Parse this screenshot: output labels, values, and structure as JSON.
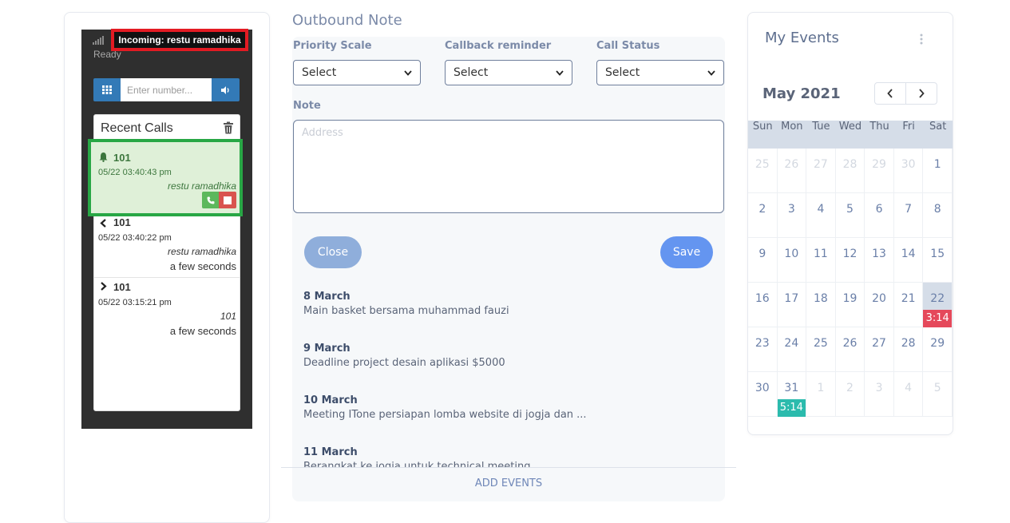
{
  "softphone": {
    "status": "Ready",
    "incoming_banner": "Incoming: restu ramadhika",
    "number_placeholder": "Enter number...",
    "recent_calls_title": "Recent Calls",
    "calls": [
      {
        "number": "101",
        "time": "05/22 03:40:43 pm",
        "name": "restu ramadhika",
        "direction": "incoming-ringing"
      },
      {
        "number": "101",
        "time": "05/22 03:40:22 pm",
        "name": "restu ramadhika",
        "ago": "a few seconds",
        "direction": "incoming"
      },
      {
        "number": "101",
        "time": "05/22 03:15:21 pm",
        "name": "101",
        "ago": "a few seconds",
        "direction": "outgoing"
      }
    ],
    "colors": {
      "incoming_border": "#e31b23",
      "active_call_border": "#28a745",
      "button_blue": "#337ab7"
    }
  },
  "outbound": {
    "title": "Outbound Note",
    "fields": {
      "priority_label": "Priority Scale",
      "priority_value": "Select",
      "callback_label": "Callback reminder",
      "callback_value": "Select",
      "status_label": "Call Status",
      "status_value": "Select",
      "note_label": "Note",
      "note_placeholder": "Address"
    },
    "close_label": "Close",
    "save_label": "Save",
    "events": [
      {
        "date": "8 March",
        "desc": "Main basket bersama muhammad fauzi"
      },
      {
        "date": "9 March",
        "desc": "Deadline project desain aplikasi $5000"
      },
      {
        "date": "10 March",
        "desc": "Meeting ITone persiapan lomba website di jogja dan ..."
      },
      {
        "date": "11 March",
        "desc": "Berangkat ke jogja untuk technical meeting"
      }
    ],
    "add_events_label": "ADD EVENTS"
  },
  "calendar": {
    "title": "My Events",
    "month": "May 2021",
    "weekdays": [
      "Sun",
      "Mon",
      "Tue",
      "Wed",
      "Thu",
      "Fri",
      "Sat"
    ],
    "weeks": [
      [
        "25",
        "26",
        "27",
        "28",
        "29",
        "30",
        "1"
      ],
      [
        "2",
        "3",
        "4",
        "5",
        "6",
        "7",
        "8"
      ],
      [
        "9",
        "10",
        "11",
        "12",
        "13",
        "14",
        "15"
      ],
      [
        "16",
        "17",
        "18",
        "19",
        "20",
        "21",
        "22"
      ],
      [
        "23",
        "24",
        "25",
        "26",
        "27",
        "28",
        "29"
      ],
      [
        "30",
        "31",
        "1",
        "2",
        "3",
        "4",
        "5"
      ]
    ],
    "today": "22",
    "events": [
      {
        "day": "22",
        "label": "3:14",
        "color": "#e5495b"
      },
      {
        "day": "31",
        "label": "5:14",
        "color": "#2bbbad"
      }
    ]
  }
}
